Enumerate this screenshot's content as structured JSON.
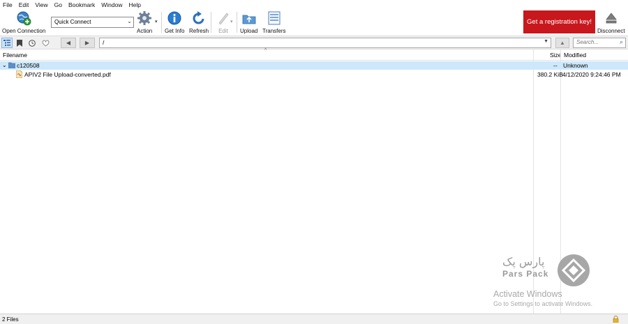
{
  "menu": [
    "File",
    "Edit",
    "View",
    "Go",
    "Bookmark",
    "Window",
    "Help"
  ],
  "toolbar": {
    "open_connection": "Open Connection",
    "quick_connect": "Quick Connect",
    "action": "Action",
    "get_info": "Get Info",
    "refresh": "Refresh",
    "edit": "Edit",
    "upload": "Upload",
    "transfers": "Transfers",
    "register": "Get a registration key!",
    "disconnect": "Disconnect"
  },
  "pathbar": {
    "path": "/",
    "search_placeholder": "Search..."
  },
  "columns": {
    "filename": "Filename",
    "size": "Size",
    "modified": "Modified"
  },
  "rows": [
    {
      "name": "c120508",
      "size": "--",
      "modified": "Unknown",
      "type": "folder",
      "expanded": true
    },
    {
      "name": "APIV2 File Upload-converted.pdf",
      "size": "380.2 KiB",
      "modified": "4/12/2020 9:24:46 PM",
      "type": "file"
    }
  ],
  "watermark": {
    "logo_fa": "پارس پک",
    "logo_en": "Pars Pack",
    "activate_title": "Activate Windows",
    "activate_sub": "Go to Settings to activate Windows."
  },
  "status": {
    "count": "2 Files"
  },
  "colors": {
    "register_bg": "#c8171d",
    "selection": "#cde8fb"
  }
}
